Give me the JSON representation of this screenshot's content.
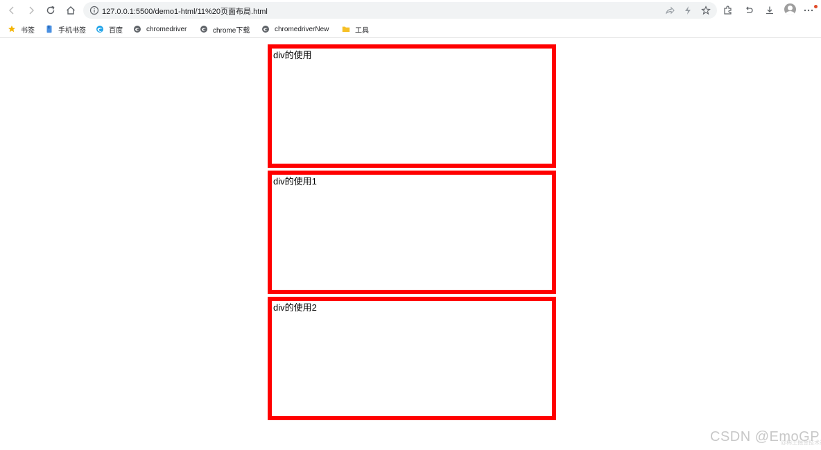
{
  "address_bar": {
    "url": "127.0.0.1:5500/demo1-html/11%20页面布局.html"
  },
  "icons": {
    "back": "back-arrow-icon",
    "forward": "forward-arrow-icon",
    "reload": "reload-icon",
    "home": "home-icon",
    "site_info": "info-circle-icon",
    "share": "share-icon",
    "performance": "lightning-icon",
    "favorite": "star-outline-icon",
    "extensions": "extensions-icon",
    "history": "undo-icon",
    "downloads": "download-icon",
    "profile": "profile-avatar-icon",
    "more": "more-dots-icon"
  },
  "bookmarks": [
    {
      "label": "书签",
      "icon": "star-icon",
      "color": "#f4b400"
    },
    {
      "label": "手机书签",
      "icon": "mobile-bookmark-icon",
      "color": "#4a90e2"
    },
    {
      "label": "百度",
      "icon": "edge-icon",
      "color": "#1fa3e8"
    },
    {
      "label": "chromedriver",
      "icon": "site-icon",
      "color": "#5f6368"
    },
    {
      "label": "chrome下载",
      "icon": "site-icon",
      "color": "#5f6368"
    },
    {
      "label": "chromedriverNew",
      "icon": "site-icon",
      "color": "#5f6368"
    },
    {
      "label": "工具",
      "icon": "folder-icon",
      "color": "#f6c026"
    }
  ],
  "page": {
    "divs": [
      {
        "text": "div的使用"
      },
      {
        "text": "div的使用1"
      },
      {
        "text": "div的使用2"
      }
    ],
    "border_color": "#ff0000"
  },
  "watermark": {
    "main": "CSDN @EmoGP",
    "small": "@稀土掘金技术社区"
  }
}
